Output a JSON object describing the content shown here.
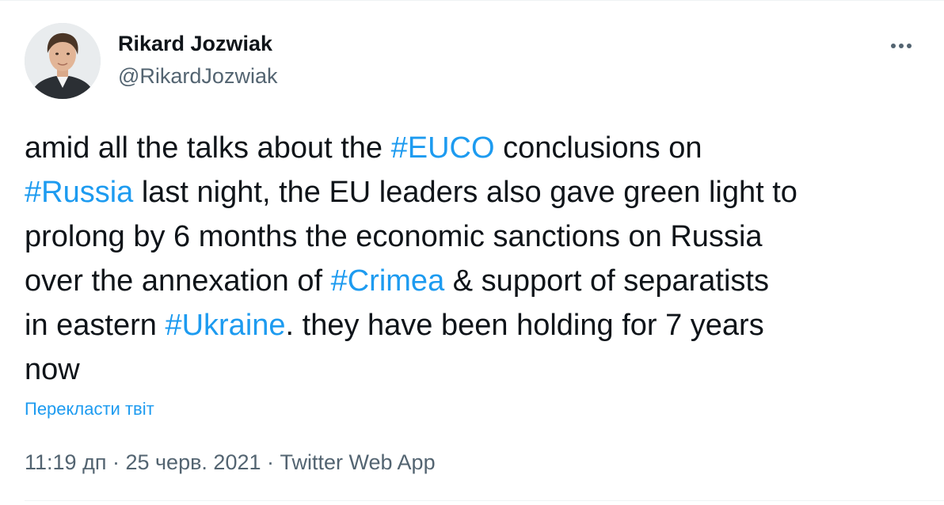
{
  "author": {
    "name": "Rikard Jozwiak",
    "handle": "@RikardJozwiak"
  },
  "icons": {
    "avatar": "profile-photo",
    "more": "more-horizontal-icon"
  },
  "tweet": {
    "line1": [
      "amid all the talks about the ",
      "#EUCO",
      " conclusions on"
    ],
    "line2": [
      "#Russia",
      " last night, the EU leaders also gave green light to"
    ],
    "line3": "prolong by 6 months the economic sanctions on Russia",
    "line4": [
      "over the annexation of ",
      "#Crimea",
      " & support of separatists"
    ],
    "line5": [
      "in eastern ",
      "#Ukraine",
      ". they have been holding for 7 years"
    ],
    "line6": "now"
  },
  "translate_label": "Перекласти твіт",
  "meta": {
    "time": "11:19 дп",
    "separator": " · ",
    "date": "25 черв. 2021",
    "source": "Twitter Web App"
  },
  "colors": {
    "link": "#1d9bf0",
    "text": "#0f1419",
    "secondary": "#536471",
    "border": "#eff3f4"
  }
}
